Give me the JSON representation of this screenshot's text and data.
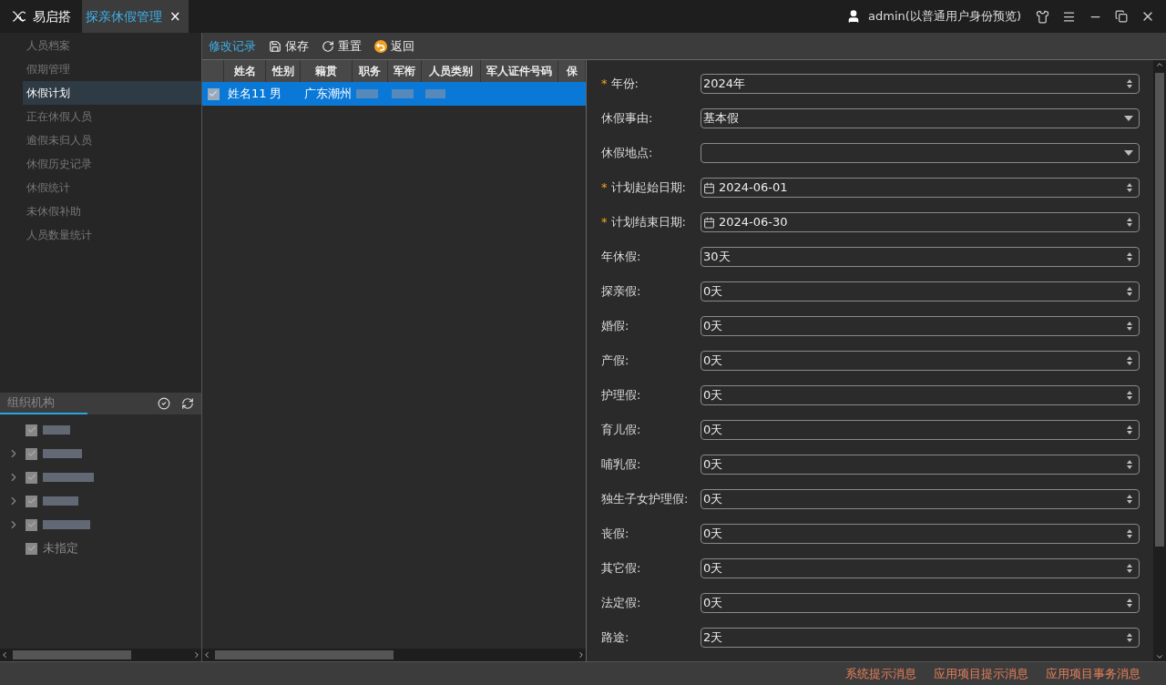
{
  "app": {
    "name": "易启搭"
  },
  "tabs": [
    {
      "label": "探亲休假管理",
      "selected": true,
      "close": "×"
    }
  ],
  "user": {
    "label": "admin(以普通用户身份预览)"
  },
  "nav": [
    {
      "label": "人员档案",
      "selected": false
    },
    {
      "label": "假期管理",
      "selected": false
    },
    {
      "label": "休假计划",
      "selected": true
    },
    {
      "label": "正在休假人员",
      "selected": false
    },
    {
      "label": "逾假未归人员",
      "selected": false
    },
    {
      "label": "休假历史记录",
      "selected": false
    },
    {
      "label": "休假统计",
      "selected": false
    },
    {
      "label": "未休假补助",
      "selected": false
    },
    {
      "label": "人员数量统计",
      "selected": false
    }
  ],
  "org": {
    "placeholder": "组织机构",
    "tree": [
      {
        "expandable": false,
        "checked": true
      },
      {
        "expandable": true,
        "checked": true
      },
      {
        "expandable": true,
        "checked": true
      },
      {
        "expandable": true,
        "checked": true
      },
      {
        "expandable": true,
        "checked": true
      },
      {
        "label": "未指定",
        "expandable": false,
        "checked": true
      }
    ]
  },
  "toolbar": [
    {
      "label": "修改记录",
      "kind": "link"
    },
    {
      "label": "保存",
      "kind": "save"
    },
    {
      "label": "重置",
      "kind": "reset"
    },
    {
      "label": "返回",
      "kind": "back"
    }
  ],
  "table": {
    "columns": [
      "姓名",
      "性别",
      "籍贯",
      "职务",
      "军衔",
      "人员类别",
      "军人证件号码",
      "保"
    ],
    "rows": [
      {
        "selected": true,
        "checked": true,
        "cells": [
          "姓名11",
          "男",
          "广东潮州",
          "",
          "",
          "",
          "",
          ""
        ]
      }
    ]
  },
  "form": [
    {
      "label": "年份:",
      "required_mark": "*",
      "kind": "spinner",
      "value": "2024年"
    },
    {
      "label": "休假事由:",
      "kind": "dropdown",
      "value": "基本假"
    },
    {
      "label": "休假地点:",
      "kind": "dropdown"
    },
    {
      "label": "计划起始日期:",
      "required_mark": "*",
      "kind": "date",
      "value": "2024-06-01"
    },
    {
      "label": "计划结束日期:",
      "required_mark": "*",
      "kind": "date",
      "value": "2024-06-30"
    },
    {
      "label": "年休假:",
      "kind": "spinner",
      "value": "30天"
    },
    {
      "label": "探亲假:",
      "kind": "spinner",
      "value": "0天"
    },
    {
      "label": "婚假:",
      "kind": "spinner",
      "value": "0天"
    },
    {
      "label": "产假:",
      "kind": "spinner",
      "value": "0天"
    },
    {
      "label": "护理假:",
      "kind": "spinner",
      "value": "0天"
    },
    {
      "label": "育儿假:",
      "kind": "spinner",
      "value": "0天"
    },
    {
      "label": "哺乳假:",
      "kind": "spinner",
      "value": "0天"
    },
    {
      "label": "独生子女护理假:",
      "kind": "spinner",
      "value": "0天"
    },
    {
      "label": "丧假:",
      "kind": "spinner",
      "value": "0天"
    },
    {
      "label": "其它假:",
      "kind": "spinner",
      "value": "0天"
    },
    {
      "label": "法定假:",
      "kind": "spinner",
      "value": "0天"
    },
    {
      "label": "路途:",
      "kind": "spinner",
      "value": "2天"
    }
  ],
  "status_bar": [
    "系统提示消息",
    "应用项目提示消息",
    "应用项目事务消息"
  ]
}
